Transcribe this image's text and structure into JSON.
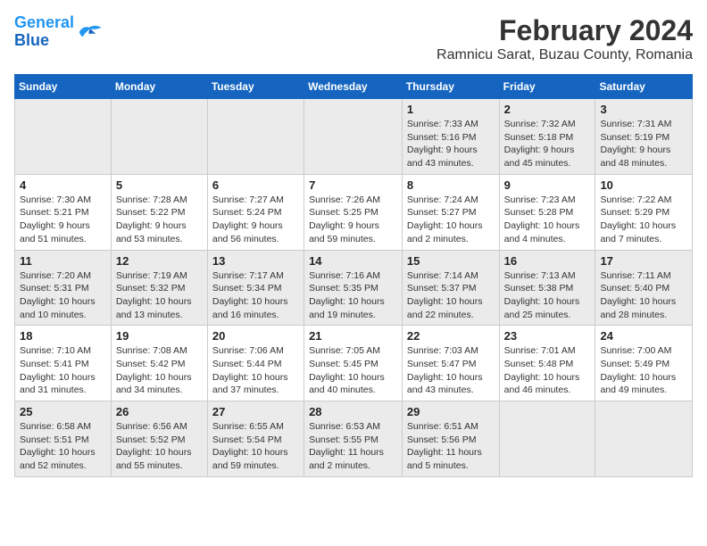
{
  "logo": {
    "line1": "General",
    "line2": "Blue"
  },
  "title": "February 2024",
  "subtitle": "Ramnicu Sarat, Buzau County, Romania",
  "days_header": [
    "Sunday",
    "Monday",
    "Tuesday",
    "Wednesday",
    "Thursday",
    "Friday",
    "Saturday"
  ],
  "weeks": [
    [
      {
        "num": "",
        "info": ""
      },
      {
        "num": "",
        "info": ""
      },
      {
        "num": "",
        "info": ""
      },
      {
        "num": "",
        "info": ""
      },
      {
        "num": "1",
        "info": "Sunrise: 7:33 AM\nSunset: 5:16 PM\nDaylight: 9 hours\nand 43 minutes."
      },
      {
        "num": "2",
        "info": "Sunrise: 7:32 AM\nSunset: 5:18 PM\nDaylight: 9 hours\nand 45 minutes."
      },
      {
        "num": "3",
        "info": "Sunrise: 7:31 AM\nSunset: 5:19 PM\nDaylight: 9 hours\nand 48 minutes."
      }
    ],
    [
      {
        "num": "4",
        "info": "Sunrise: 7:30 AM\nSunset: 5:21 PM\nDaylight: 9 hours\nand 51 minutes."
      },
      {
        "num": "5",
        "info": "Sunrise: 7:28 AM\nSunset: 5:22 PM\nDaylight: 9 hours\nand 53 minutes."
      },
      {
        "num": "6",
        "info": "Sunrise: 7:27 AM\nSunset: 5:24 PM\nDaylight: 9 hours\nand 56 minutes."
      },
      {
        "num": "7",
        "info": "Sunrise: 7:26 AM\nSunset: 5:25 PM\nDaylight: 9 hours\nand 59 minutes."
      },
      {
        "num": "8",
        "info": "Sunrise: 7:24 AM\nSunset: 5:27 PM\nDaylight: 10 hours\nand 2 minutes."
      },
      {
        "num": "9",
        "info": "Sunrise: 7:23 AM\nSunset: 5:28 PM\nDaylight: 10 hours\nand 4 minutes."
      },
      {
        "num": "10",
        "info": "Sunrise: 7:22 AM\nSunset: 5:29 PM\nDaylight: 10 hours\nand 7 minutes."
      }
    ],
    [
      {
        "num": "11",
        "info": "Sunrise: 7:20 AM\nSunset: 5:31 PM\nDaylight: 10 hours\nand 10 minutes."
      },
      {
        "num": "12",
        "info": "Sunrise: 7:19 AM\nSunset: 5:32 PM\nDaylight: 10 hours\nand 13 minutes."
      },
      {
        "num": "13",
        "info": "Sunrise: 7:17 AM\nSunset: 5:34 PM\nDaylight: 10 hours\nand 16 minutes."
      },
      {
        "num": "14",
        "info": "Sunrise: 7:16 AM\nSunset: 5:35 PM\nDaylight: 10 hours\nand 19 minutes."
      },
      {
        "num": "15",
        "info": "Sunrise: 7:14 AM\nSunset: 5:37 PM\nDaylight: 10 hours\nand 22 minutes."
      },
      {
        "num": "16",
        "info": "Sunrise: 7:13 AM\nSunset: 5:38 PM\nDaylight: 10 hours\nand 25 minutes."
      },
      {
        "num": "17",
        "info": "Sunrise: 7:11 AM\nSunset: 5:40 PM\nDaylight: 10 hours\nand 28 minutes."
      }
    ],
    [
      {
        "num": "18",
        "info": "Sunrise: 7:10 AM\nSunset: 5:41 PM\nDaylight: 10 hours\nand 31 minutes."
      },
      {
        "num": "19",
        "info": "Sunrise: 7:08 AM\nSunset: 5:42 PM\nDaylight: 10 hours\nand 34 minutes."
      },
      {
        "num": "20",
        "info": "Sunrise: 7:06 AM\nSunset: 5:44 PM\nDaylight: 10 hours\nand 37 minutes."
      },
      {
        "num": "21",
        "info": "Sunrise: 7:05 AM\nSunset: 5:45 PM\nDaylight: 10 hours\nand 40 minutes."
      },
      {
        "num": "22",
        "info": "Sunrise: 7:03 AM\nSunset: 5:47 PM\nDaylight: 10 hours\nand 43 minutes."
      },
      {
        "num": "23",
        "info": "Sunrise: 7:01 AM\nSunset: 5:48 PM\nDaylight: 10 hours\nand 46 minutes."
      },
      {
        "num": "24",
        "info": "Sunrise: 7:00 AM\nSunset: 5:49 PM\nDaylight: 10 hours\nand 49 minutes."
      }
    ],
    [
      {
        "num": "25",
        "info": "Sunrise: 6:58 AM\nSunset: 5:51 PM\nDaylight: 10 hours\nand 52 minutes."
      },
      {
        "num": "26",
        "info": "Sunrise: 6:56 AM\nSunset: 5:52 PM\nDaylight: 10 hours\nand 55 minutes."
      },
      {
        "num": "27",
        "info": "Sunrise: 6:55 AM\nSunset: 5:54 PM\nDaylight: 10 hours\nand 59 minutes."
      },
      {
        "num": "28",
        "info": "Sunrise: 6:53 AM\nSunset: 5:55 PM\nDaylight: 11 hours\nand 2 minutes."
      },
      {
        "num": "29",
        "info": "Sunrise: 6:51 AM\nSunset: 5:56 PM\nDaylight: 11 hours\nand 5 minutes."
      },
      {
        "num": "",
        "info": ""
      },
      {
        "num": "",
        "info": ""
      }
    ]
  ]
}
